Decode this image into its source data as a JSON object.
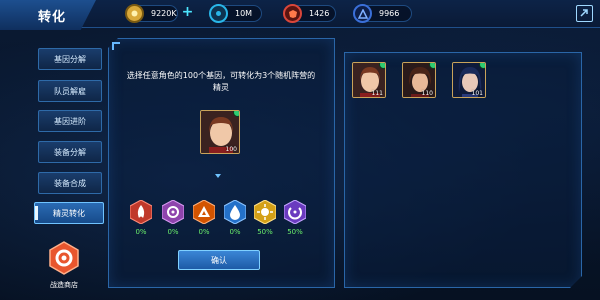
{
  "header": {
    "title": "转化",
    "resources": [
      {
        "icon": "gold-coin-icon",
        "value": "9220K",
        "color": "#d9a93a"
      },
      {
        "icon": "diamond-token-icon",
        "value": "10M",
        "color": "#29b6e8"
      },
      {
        "icon": "red-shield-token-icon",
        "value": "1426",
        "color": "#d9463a"
      },
      {
        "icon": "blue-triangle-token-icon",
        "value": "9966",
        "color": "#3a6fd9"
      }
    ],
    "add_icon": "plus-icon",
    "exit_icon": "exit-icon"
  },
  "sidebar": {
    "items": [
      {
        "label": "基因分解"
      },
      {
        "label": "队员解雇"
      },
      {
        "label": "基因进阶"
      },
      {
        "label": "装备分解"
      },
      {
        "label": "装备合成"
      },
      {
        "label": "精灵转化",
        "active": true
      }
    ],
    "shop_label": "战造商店"
  },
  "left_panel": {
    "description": "选择任意角色的100个基因，可转化为3个随机阵营的精灵",
    "selected_character": {
      "level": "100"
    },
    "spirits": [
      {
        "icon": "fire-spirit-icon",
        "color": "#c0392b",
        "percent": "0%"
      },
      {
        "icon": "void-spirit-icon",
        "color": "#8e44ad",
        "percent": "0%"
      },
      {
        "icon": "earth-spirit-icon",
        "color": "#d35400",
        "percent": "0%"
      },
      {
        "icon": "water-spirit-icon",
        "color": "#2471c9",
        "percent": "0%"
      },
      {
        "icon": "light-spirit-icon",
        "color": "#d4a017",
        "percent": "50%"
      },
      {
        "icon": "dark-spirit-icon",
        "color": "#6a3bbf",
        "percent": "50%"
      }
    ],
    "confirm_label": "确认"
  },
  "right_panel": {
    "characters": [
      {
        "level": "111"
      },
      {
        "level": "110"
      },
      {
        "level": "101"
      }
    ]
  }
}
